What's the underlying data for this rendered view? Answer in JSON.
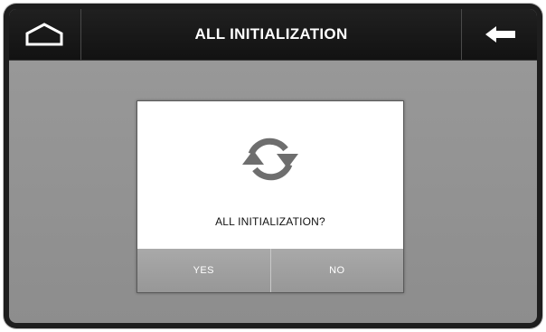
{
  "header": {
    "title": "ALL INITIALIZATION",
    "home_icon": "home-icon",
    "back_icon": "back-arrow-icon"
  },
  "dialog": {
    "icon": "refresh-icon",
    "message": "ALL INITIALIZATION?",
    "yes_label": "YES",
    "no_label": "NO"
  },
  "colors": {
    "header_bg": "#161616",
    "screen_bg": "#949494",
    "dialog_bg": "#ffffff",
    "button_bg": "#a0a0a0",
    "icon_color": "#6e6e6e"
  }
}
